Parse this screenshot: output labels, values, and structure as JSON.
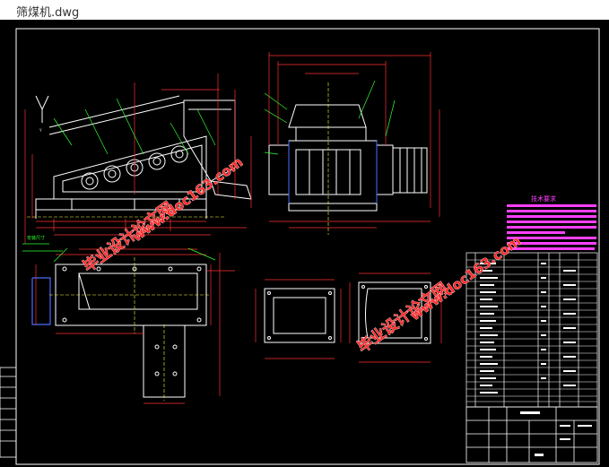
{
  "window": {
    "title": "筛煤机.dwg"
  },
  "drawing": {
    "tech_req_heading": "技术要求",
    "watermark_text_1": "毕业设计论文网",
    "watermark_url_1": "www.doc163.com",
    "watermark_text_2": "毕业设计论文网",
    "watermark_url_2": "www.doc163.com",
    "left_label_a": "Y",
    "left_label_b": "安装尺寸",
    "colors": {
      "background": "#000000",
      "frame": "#ffffff",
      "machine": "#ffffff",
      "dimension": "#ff3030",
      "leader": "#30ff30",
      "center": "#ffff40",
      "blue": "#4a6cff",
      "magenta": "#ff40ff",
      "watermark": "#ff2d2d"
    }
  },
  "icons": {
    "tech_block": "magenta-bars-icon",
    "drawing": "cad-canvas-icon"
  }
}
